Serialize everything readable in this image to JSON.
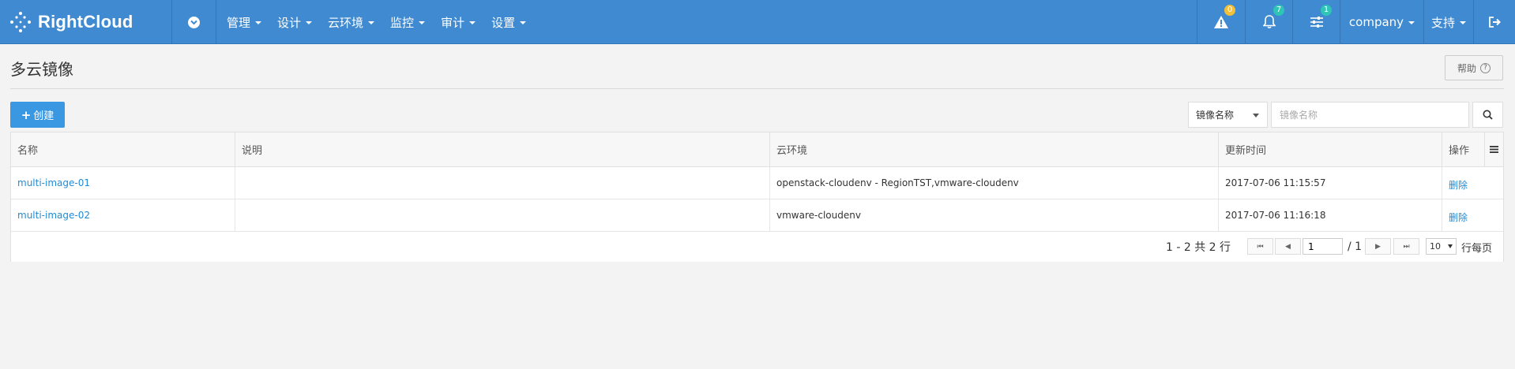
{
  "brand": {
    "name": "RightCloud"
  },
  "nav": {
    "menu": [
      {
        "label": "管理"
      },
      {
        "label": "设计"
      },
      {
        "label": "云环境"
      },
      {
        "label": "监控"
      },
      {
        "label": "审计"
      },
      {
        "label": "设置"
      }
    ],
    "alerts_count": "0",
    "notifications_count": "7",
    "tasks_count": "1",
    "company": "company",
    "support": "支持"
  },
  "page": {
    "title": "多云镜像",
    "help_label": "帮助"
  },
  "toolbar": {
    "create_label": "创建",
    "search_field": "镜像名称",
    "search_placeholder": "镜像名称"
  },
  "table": {
    "columns": [
      "名称",
      "说明",
      "云环境",
      "更新时间",
      "操作"
    ],
    "rows": [
      {
        "name": "multi-image-01",
        "description": "",
        "cloud_env": "openstack-cloudenv - RegionTST,vmware-cloudenv",
        "updated": "2017-07-06 11:15:57",
        "action": "删除"
      },
      {
        "name": "multi-image-02",
        "description": "",
        "cloud_env": "vmware-cloudenv",
        "updated": "2017-07-06 11:16:18",
        "action": "删除"
      }
    ]
  },
  "pagination": {
    "summary": "1 - 2 共 2 行",
    "current_page": "1",
    "total_pages": "/ 1",
    "page_size": "10",
    "per_page_label": "行每页"
  },
  "colors": {
    "navbar": "#3f8ad0",
    "primary_button": "#3a97e1",
    "link": "#1f8bd6",
    "badge_yellow": "#f2c037",
    "badge_teal": "#2ec4b6"
  }
}
